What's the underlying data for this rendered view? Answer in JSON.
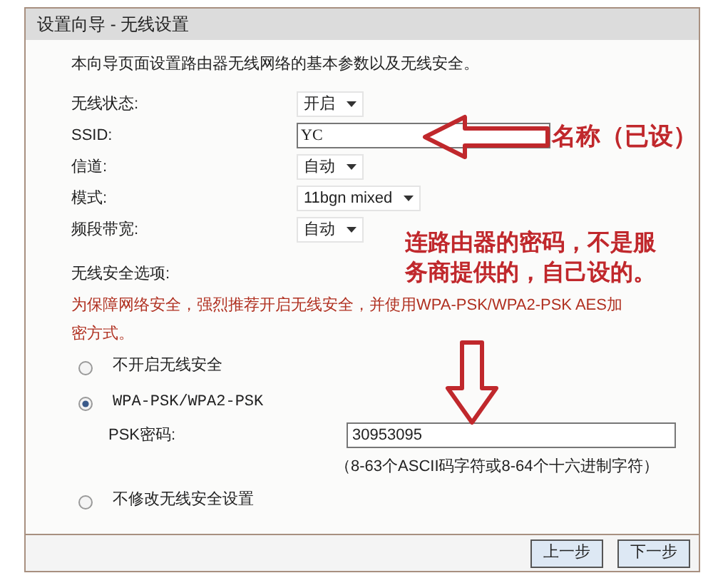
{
  "window": {
    "title": "设置向导 - 无线设置"
  },
  "description": "本向导页面设置路由器无线网络的基本参数以及无线安全。",
  "fields": [
    {
      "kind": "select",
      "label": "无线状态:",
      "value": "开启"
    },
    {
      "kind": "input",
      "label": "SSID:",
      "value": "YC"
    },
    {
      "kind": "select",
      "label": "信道:",
      "value": "自动"
    },
    {
      "kind": "select",
      "label": "模式:",
      "value": "11bgn mixed"
    },
    {
      "kind": "select",
      "label": "频段带宽:",
      "value": "自动"
    }
  ],
  "security": {
    "title": "无线安全选项:",
    "warning": "为保障网络安全，强烈推荐开启无线安全，并使用WPA-PSK/WPA2-PSK AES加密方式。",
    "options": [
      {
        "label": "不开启无线安全",
        "selected": false
      },
      {
        "label": "WPA-PSK/WPA2-PSK",
        "selected": true,
        "psk_label": "PSK密码:",
        "psk_value": "30953095",
        "psk_hint": "（8-63个ASCII码字符或8-64个十六进制字符）"
      },
      {
        "label": "不修改无线安全设置",
        "selected": false
      }
    ]
  },
  "buttons": [
    "上一步",
    "下一步"
  ],
  "annotations": [
    {
      "kind": "left-arrow",
      "text": "名称（已设）"
    },
    {
      "kind": "down-arrow",
      "lines": [
        "连路由器的密码，不是服",
        "务商提供的，自己设的。"
      ]
    }
  ]
}
